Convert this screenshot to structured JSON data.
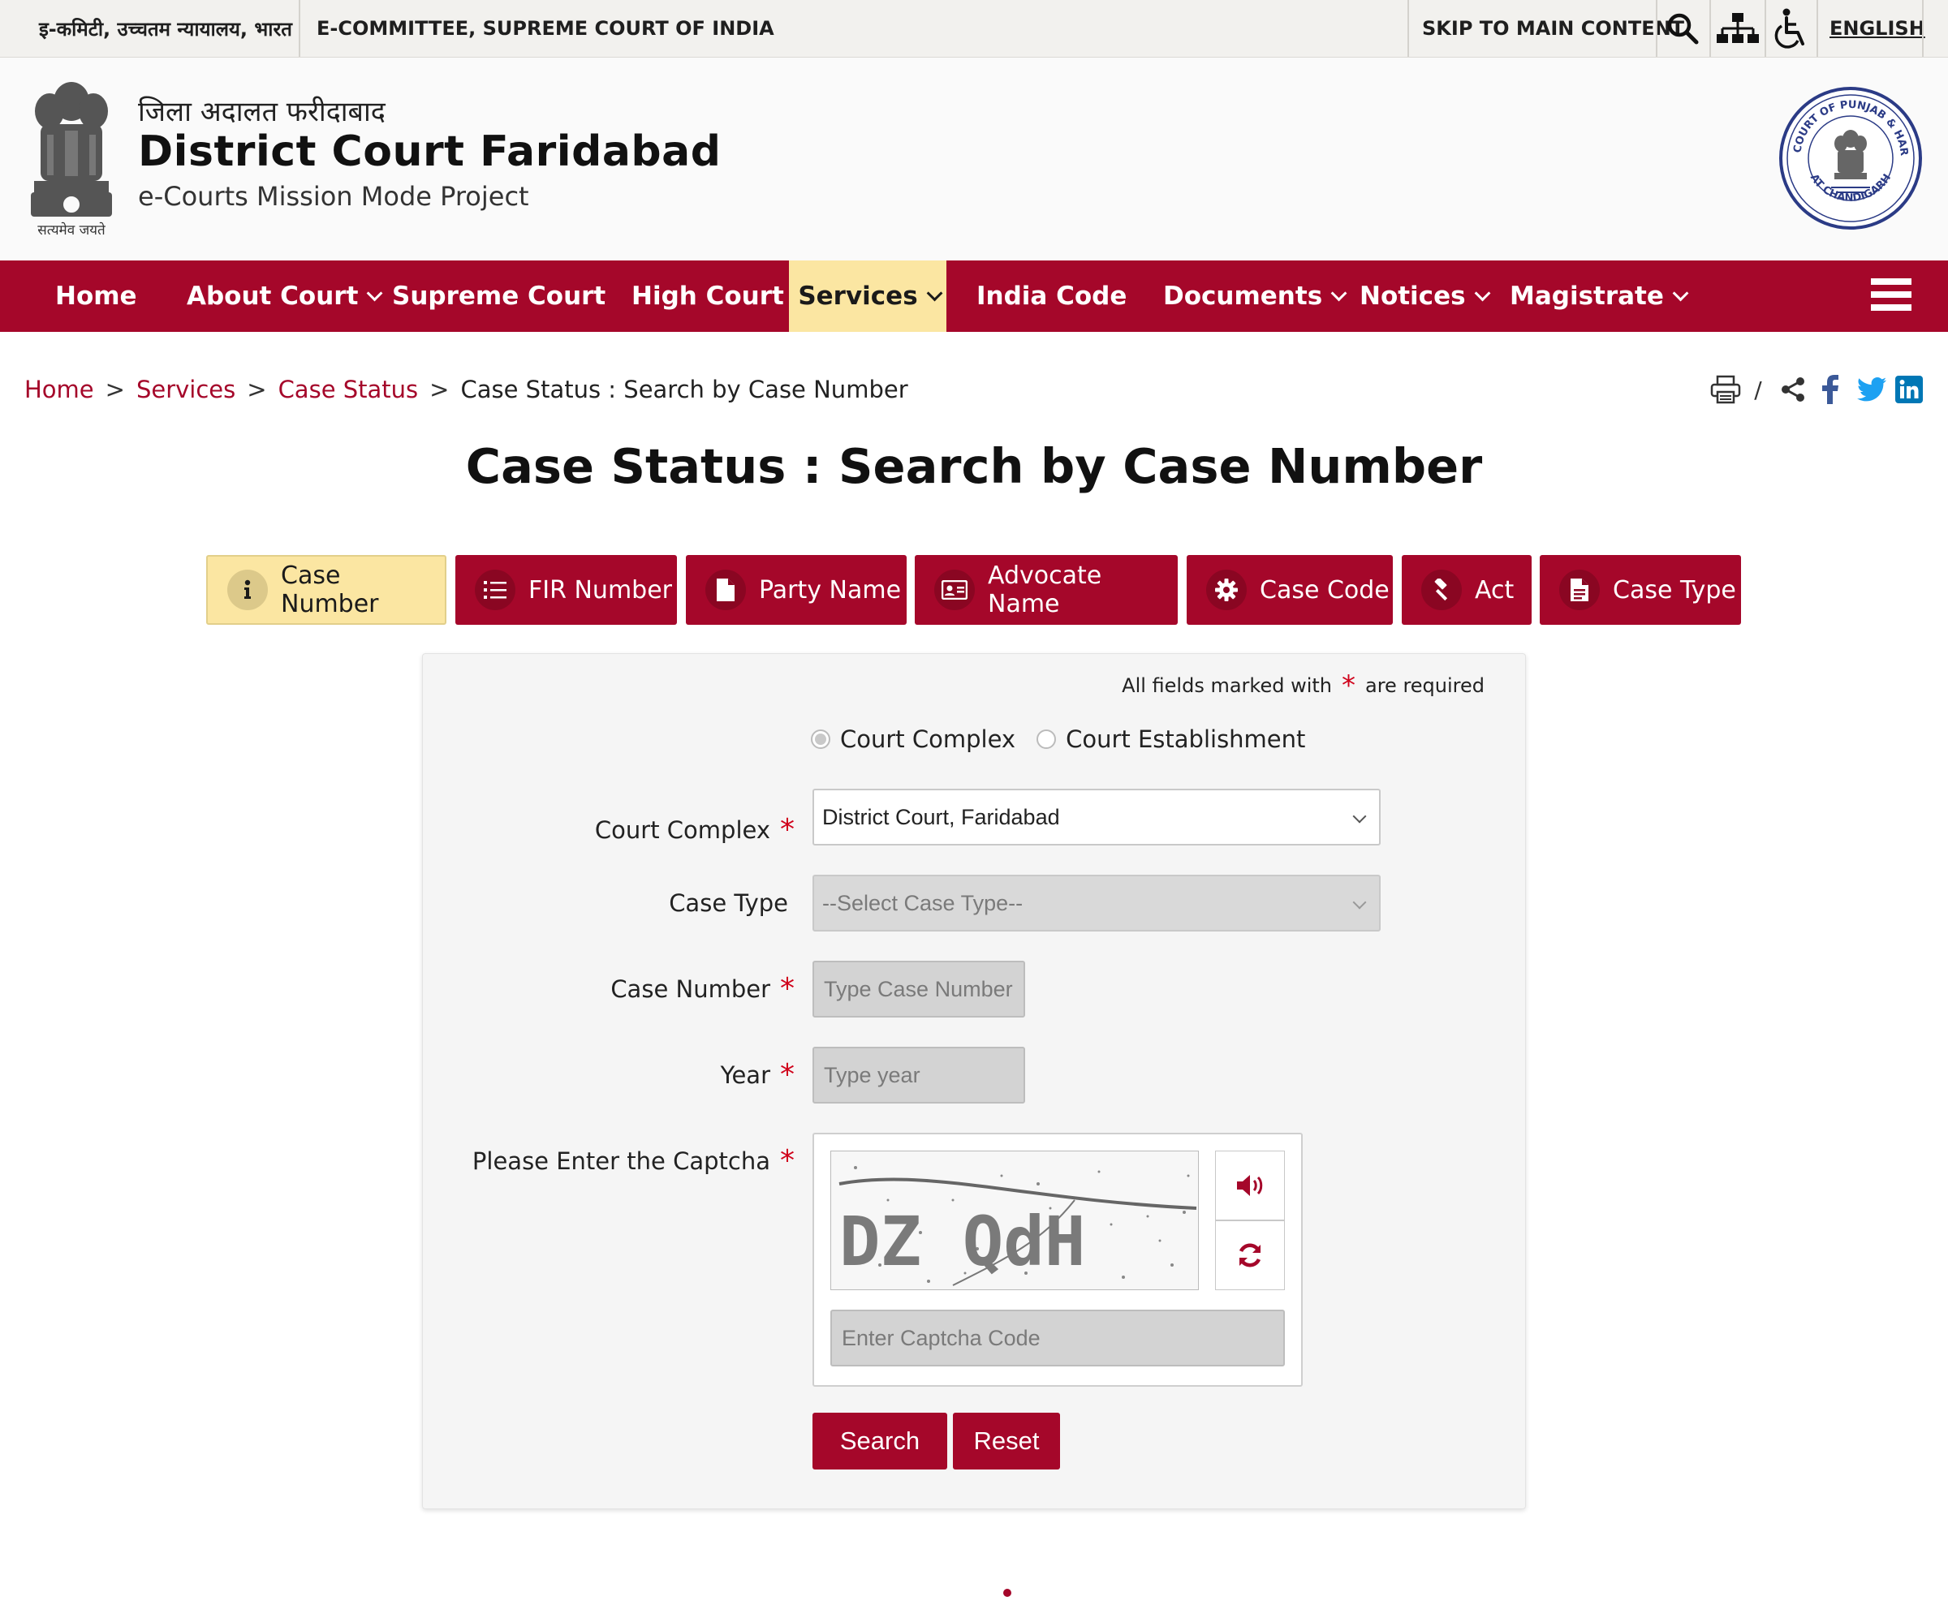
{
  "topbar": {
    "hindi_label": "इ-कमिटी, उच्चतम न्यायालय, भारत",
    "english_label": "E-COMMITTEE, SUPREME COURT OF INDIA",
    "skip_link": "SKIP TO MAIN CONTENT",
    "language": "ENGLISH"
  },
  "header": {
    "hindi_title": "जिला अदालत फरीदाबाद",
    "title": "District Court Faridabad",
    "subtitle": "e-Courts Mission Mode Project",
    "emblem_motto": "सत्यमेव जयते",
    "seal_text_top": "HIGH COURT OF PUNJAB & HARYANA",
    "seal_text_bottom": "AT CHANDIGARH"
  },
  "nav": {
    "items": [
      {
        "label": "Home"
      },
      {
        "label": "About Court"
      },
      {
        "label": "Supreme Court"
      },
      {
        "label": "High Court"
      },
      {
        "label": "Services"
      },
      {
        "label": "India Code"
      },
      {
        "label": "Documents"
      },
      {
        "label": "Notices"
      },
      {
        "label": "Magistrate"
      }
    ]
  },
  "breadcrumb": {
    "items": [
      {
        "label": "Home"
      },
      {
        "label": "Services"
      },
      {
        "label": "Case Status"
      },
      {
        "label": "Case Status : Search by Case Number"
      }
    ],
    "separator": ">",
    "print_divider": "/"
  },
  "page_title": "Case Status : Search by Case Number",
  "tabs": [
    {
      "label": "Case Number"
    },
    {
      "label": "FIR Number"
    },
    {
      "label": "Party Name"
    },
    {
      "label": "Advocate Name"
    },
    {
      "label": "Case Code"
    },
    {
      "label": "Act"
    },
    {
      "label": "Case Type"
    }
  ],
  "form": {
    "required_prefix": "All fields marked with",
    "required_star": "*",
    "required_suffix": "are required",
    "radio_court_complex": "Court Complex",
    "radio_court_establishment": "Court Establishment",
    "court_complex_label": "Court Complex",
    "court_complex_value": "District Court, Faridabad",
    "case_type_label": "Case Type",
    "case_type_placeholder": "--Select Case Type--",
    "case_number_label": "Case Number",
    "case_number_placeholder": "Type Case Number",
    "year_label": "Year",
    "year_placeholder": "Type year",
    "captcha_label": "Please Enter the Captcha",
    "captcha_placeholder": "Enter Captcha Code",
    "captcha_text": "DZ QdH",
    "search_button": "Search",
    "reset_button": "Reset"
  },
  "colors": {
    "brand": "#a5072a",
    "active_tab": "#fbe6a2",
    "required_star": "#d0021b"
  }
}
